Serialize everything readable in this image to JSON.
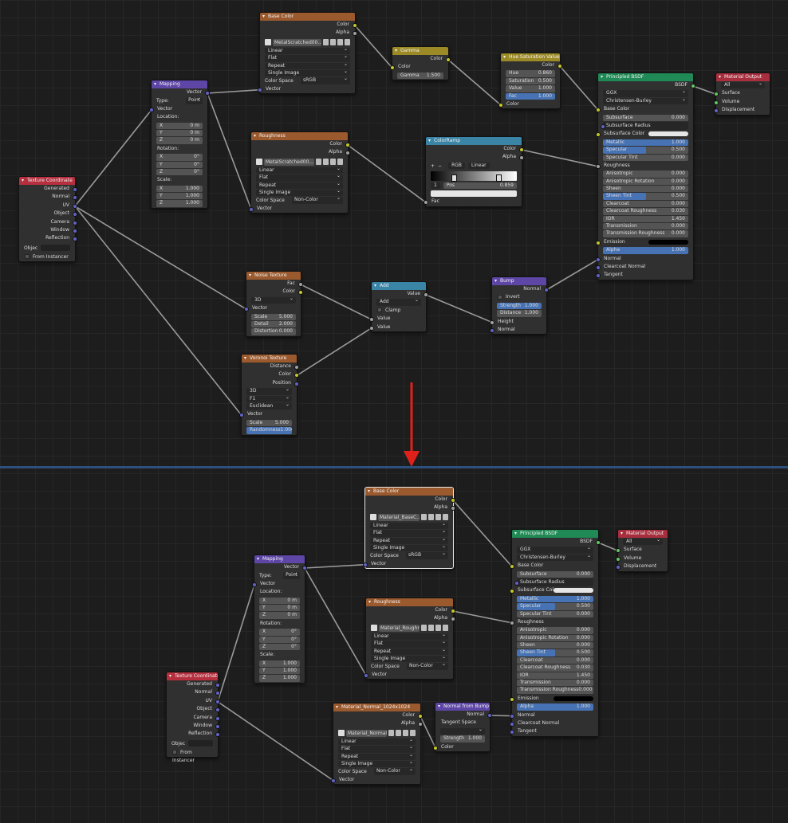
{
  "nodes": {
    "tc_top": {
      "title": "Texture Coordinate",
      "outputs": [
        "Generated",
        "Normal",
        "UV",
        "Object",
        "Camera",
        "Window",
        "Reflection"
      ],
      "object_label": "Objec",
      "from_instancer": "From Instancer"
    },
    "map_top": {
      "title": "Mapping",
      "out": "Vector",
      "type_label": "Type:",
      "type_value": "Point",
      "vector_in": "Vector",
      "location_label": "Location:",
      "location": [
        [
          "X",
          "0 m"
        ],
        [
          "Y",
          "0 m"
        ],
        [
          "Z",
          "0 m"
        ]
      ],
      "rotation_label": "Rotation:",
      "rotation": [
        [
          "X",
          "0°"
        ],
        [
          "Y",
          "0°"
        ],
        [
          "Z",
          "0°"
        ]
      ],
      "scale_label": "Scale:",
      "scale": [
        [
          "X",
          "1.000"
        ],
        [
          "Y",
          "1.000"
        ],
        [
          "Z",
          "1.000"
        ]
      ]
    },
    "base_top": {
      "title": "Base Color",
      "outs": [
        "Color",
        "Alpha"
      ],
      "image": "MetalScratched00...",
      "interp": "Linear",
      "proj": "Flat",
      "ext": "Repeat",
      "src": "Single Image",
      "cs_label": "Color Space",
      "cs_value": "sRGB",
      "vector_in": "Vector"
    },
    "gamma": {
      "title": "Gamma",
      "out": "Color",
      "in_color": "Color",
      "gamma_label": "Gamma",
      "gamma_value": "1.500"
    },
    "hue": {
      "title": "Hue Saturation Value",
      "out": "Color",
      "fields": [
        [
          "Hue",
          "0.860"
        ],
        [
          "Saturation",
          "0.500"
        ],
        [
          "Value",
          "1.000"
        ],
        [
          "Fac",
          "1.000"
        ]
      ],
      "in_color": "Color"
    },
    "rough_top": {
      "title": "Roughness",
      "outs": [
        "Color",
        "Alpha"
      ],
      "image": "MetalScratched00...",
      "interp": "Linear",
      "proj": "Flat",
      "ext": "Repeat",
      "src": "Single Image",
      "cs_label": "Color Space",
      "cs_value": "Non-Color",
      "vector_in": "Vector"
    },
    "ramp": {
      "title": "ColorRamp",
      "outs": [
        "Color",
        "Alpha"
      ],
      "plus": "+",
      "minus": "−",
      "mode": "RGB",
      "interp": "Linear",
      "index": "1",
      "pos_label": "Pos",
      "pos_value": "0.859",
      "fac_in": "Fac"
    },
    "bsdf_top": {
      "title": "Principled BSDF",
      "out": "BSDF",
      "dist": "GGX",
      "sss": "Christensen-Burley",
      "rows": [
        [
          "Base Color",
          "socket",
          ""
        ],
        [
          "Subsurface",
          "field",
          "0.000"
        ],
        [
          "Subsurface Radius",
          "dd",
          ""
        ],
        [
          "Subsurface Color",
          "swatch",
          ""
        ],
        [
          "Metallic",
          "fill",
          "1.000"
        ],
        [
          "Specular",
          "fill",
          "0.500"
        ],
        [
          "Specular Tint",
          "field",
          "0.000"
        ],
        [
          "Roughness",
          "socket",
          ""
        ],
        [
          "Anisotropic",
          "field",
          "0.000"
        ],
        [
          "Anisotropic Rotation",
          "field",
          "0.000"
        ],
        [
          "Sheen",
          "field",
          "0.000"
        ],
        [
          "Sheen Tint",
          "fill",
          "0.500"
        ],
        [
          "Clearcoat",
          "field",
          "0.000"
        ],
        [
          "Clearcoat Roughness",
          "field",
          "0.030"
        ],
        [
          "IOR",
          "field",
          "1.450"
        ],
        [
          "Transmission",
          "field",
          "0.000"
        ],
        [
          "Transmission Roughness",
          "field",
          "0.000"
        ],
        [
          "Emission",
          "black",
          ""
        ],
        [
          "Alpha",
          "fill",
          "1.000"
        ],
        [
          "Normal",
          "socket",
          ""
        ],
        [
          "Clearcoat Normal",
          "socket",
          ""
        ],
        [
          "Tangent",
          "socket",
          ""
        ]
      ]
    },
    "out_top": {
      "title": "Material Output",
      "target": "All",
      "inputs": [
        "Surface",
        "Volume",
        "Displacement"
      ]
    },
    "noise": {
      "title": "Noise Texture",
      "outs": [
        "Fac",
        "Color"
      ],
      "dim": "3D",
      "vector_in": "Vector",
      "fields": [
        [
          "Scale",
          "5.000"
        ],
        [
          "Detail",
          "2.000"
        ],
        [
          "Distortion",
          "0.000"
        ]
      ]
    },
    "add": {
      "title": "Add",
      "out": "Value",
      "op": "Add",
      "clamp": "Clamp",
      "ins": [
        "Value",
        "Value"
      ]
    },
    "bump": {
      "title": "Bump",
      "out": "Normal",
      "invert": "Invert",
      "strength_label": "Strength",
      "strength_value": "1.000",
      "distance_label": "Distance",
      "distance_value": "1.000",
      "height": "Height",
      "normal": "Normal"
    },
    "voronoi": {
      "title": "Voronoi Texture",
      "outs": [
        "Distance",
        "Color",
        "Position"
      ],
      "dim": "3D",
      "feature": "F1",
      "metric": "Euclidean",
      "vector_in": "Vector",
      "scale_label": "Scale",
      "scale_value": "5.000",
      "rand_label": "Randomness",
      "rand_value": "1.000"
    },
    "base_bot": {
      "title": "Base Color",
      "outs": [
        "Color",
        "Alpha"
      ],
      "image": "Material_BaseC...",
      "interp": "Linear",
      "proj": "Flat",
      "ext": "Repeat",
      "src": "Single Image",
      "cs_label": "Color Space",
      "cs_value": "sRGB",
      "vector_in": "Vector"
    },
    "map_bot": {
      "title": "Mapping",
      "out": "Vector",
      "type_label": "Type:",
      "type_value": "Point",
      "vector_in": "Vector",
      "location_label": "Location:",
      "location": [
        [
          "X",
          "0 m"
        ],
        [
          "Y",
          "0 m"
        ],
        [
          "Z",
          "0 m"
        ]
      ],
      "rotation_label": "Rotation:",
      "rotation": [
        [
          "X",
          "0°"
        ],
        [
          "Y",
          "0°"
        ],
        [
          "Z",
          "0°"
        ]
      ],
      "scale_label": "Scale:",
      "scale": [
        [
          "X",
          "1.000"
        ],
        [
          "Y",
          "1.000"
        ],
        [
          "Z",
          "1.000"
        ]
      ]
    },
    "rough_bot": {
      "title": "Roughness",
      "outs": [
        "Color",
        "Alpha"
      ],
      "image": "Material_Roughn...",
      "interp": "Linear",
      "proj": "Flat",
      "ext": "Repeat",
      "src": "Single Image",
      "cs_label": "Color Space",
      "cs_value": "Non-Color",
      "vector_in": "Vector"
    },
    "tc_bot": {
      "title": "Texture Coordinate",
      "outputs": [
        "Generated",
        "Normal",
        "UV",
        "Object",
        "Camera",
        "Window",
        "Reflection"
      ],
      "object_label": "Objec",
      "from_instancer": "From Instancer"
    },
    "normal_tex": {
      "title": "Material_Normal_1024x1024",
      "outs": [
        "Color",
        "Alpha"
      ],
      "image": "Material_Normal...",
      "interp": "Linear",
      "proj": "Flat",
      "ext": "Repeat",
      "src": "Single Image",
      "cs_label": "Color Space",
      "cs_value": "Non-Color",
      "vector_in": "Vector"
    },
    "nfb": {
      "title": "Normal from Bump",
      "out": "Normal",
      "space_label": "Tangent Space",
      "space_value": "",
      "strength_label": "Strength",
      "strength_value": "1.000",
      "in_color": "Color"
    },
    "bsdf_bot": {
      "title": "Principled BSDF",
      "out": "BSDF",
      "dist": "GGX",
      "sss": "Christensen-Burley",
      "rows": [
        [
          "Base Color",
          "socket",
          ""
        ],
        [
          "Subsurface",
          "field",
          "0.000"
        ],
        [
          "Subsurface Radius",
          "dd",
          ""
        ],
        [
          "Subsurface Color",
          "swatch",
          ""
        ],
        [
          "Metallic",
          "fill",
          "1.000"
        ],
        [
          "Specular",
          "fill",
          "0.500"
        ],
        [
          "Specular Tint",
          "field",
          "0.000"
        ],
        [
          "Roughness",
          "socket",
          ""
        ],
        [
          "Anisotropic",
          "field",
          "0.000"
        ],
        [
          "Anisotropic Rotation",
          "field",
          "0.000"
        ],
        [
          "Sheen",
          "field",
          "0.000"
        ],
        [
          "Sheen Tint",
          "fill",
          "0.500"
        ],
        [
          "Clearcoat",
          "field",
          "0.000"
        ],
        [
          "Clearcoat Roughness",
          "field",
          "0.030"
        ],
        [
          "IOR",
          "field",
          "1.450"
        ],
        [
          "Transmission",
          "field",
          "0.000"
        ],
        [
          "Transmission Roughness",
          "field",
          "0.000"
        ],
        [
          "Emission",
          "black",
          ""
        ],
        [
          "Alpha",
          "fill",
          "1.000"
        ],
        [
          "Normal",
          "socket",
          ""
        ],
        [
          "Clearcoat Normal",
          "socket",
          ""
        ],
        [
          "Tangent",
          "socket",
          ""
        ]
      ]
    },
    "out_bot": {
      "title": "Material Output",
      "target": "All",
      "inputs": [
        "Surface",
        "Volume",
        "Displacement"
      ]
    }
  },
  "colors": {
    "wire": "#9a9a9a",
    "arrow": "#e0201b",
    "divider": "#2d4f7c"
  }
}
